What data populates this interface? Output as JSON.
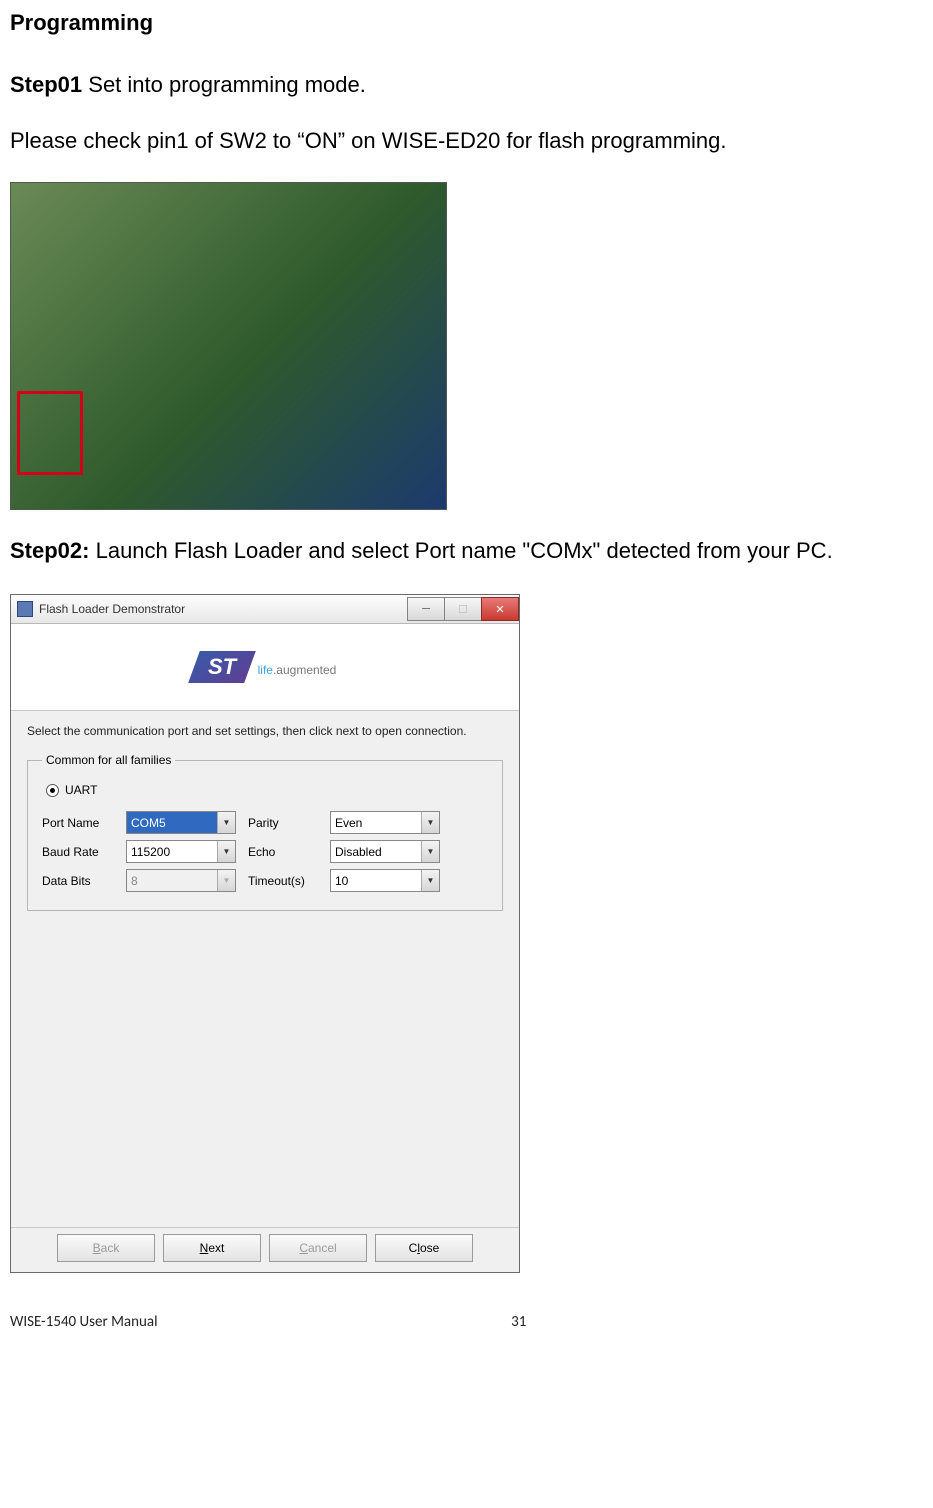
{
  "doc": {
    "heading": "Programming",
    "step01_label": "Step01",
    "step01_text": " Set into programming mode.",
    "body1": "Please check pin1 of SW2 to “ON” on WISE-ED20 for flash programming.",
    "step02_label": "Step02:",
    "step02_text": " Launch Flash Loader and select Port name \"COMx\" detected from your PC."
  },
  "window": {
    "title": "Flash Loader Demonstrator",
    "logo_text": "ST",
    "tag_life": "life",
    "tag_aug": ".augmented",
    "instruction": "Select the communication port and set settings, then click next to open connection.",
    "fieldset_legend": "Common for all families",
    "uart_label": "UART",
    "labels": {
      "port_name": "Port Name",
      "baud_rate": "Baud Rate",
      "data_bits": "Data Bits",
      "parity": "Parity",
      "echo": "Echo",
      "timeout": "Timeout(s)"
    },
    "values": {
      "port_name": "COM5",
      "baud_rate": "115200",
      "data_bits": "8",
      "parity": "Even",
      "echo": "Disabled",
      "timeout": "10"
    },
    "buttons": {
      "back": "Back",
      "next": "Next",
      "cancel": "Cancel",
      "close": "Close"
    }
  },
  "footer": {
    "left": "WISE-1540 User Manual",
    "page": "31"
  }
}
